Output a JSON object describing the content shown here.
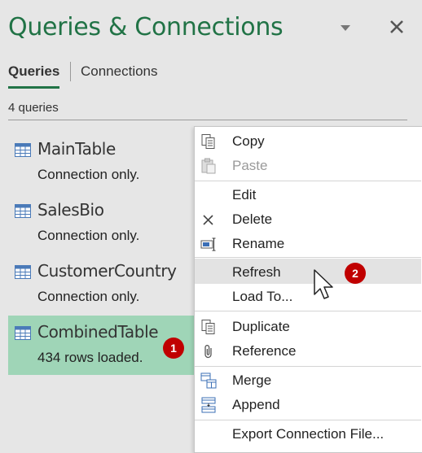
{
  "pane": {
    "title": "Queries & Connections"
  },
  "tabs": {
    "queries": "Queries",
    "connections": "Connections"
  },
  "query_count": "4 queries",
  "queries": [
    {
      "name": "MainTable",
      "status": "Connection only."
    },
    {
      "name": "SalesBio",
      "status": "Connection only."
    },
    {
      "name": "CustomerCountry",
      "status": "Connection only."
    },
    {
      "name": "CombinedTable",
      "status": "434 rows loaded."
    }
  ],
  "context_menu": {
    "items": [
      {
        "label": "Copy",
        "icon": "copy-icon"
      },
      {
        "label": "Paste",
        "icon": "paste-icon",
        "disabled": true
      },
      {
        "label": "Edit"
      },
      {
        "label": "Delete",
        "icon": "delete-icon"
      },
      {
        "label": "Rename",
        "icon": "rename-icon"
      },
      {
        "label": "Refresh",
        "hover": true
      },
      {
        "label": "Load To..."
      },
      {
        "label": "Duplicate",
        "icon": "duplicate-icon"
      },
      {
        "label": "Reference",
        "icon": "reference-icon"
      },
      {
        "label": "Merge",
        "icon": "merge-icon"
      },
      {
        "label": "Append",
        "icon": "append-icon"
      },
      {
        "label": "Export Connection File..."
      }
    ]
  },
  "callouts": {
    "first": "1",
    "second": "2"
  },
  "colors": {
    "accent": "#217346",
    "selected": "#9fd5b7",
    "badge": "#c00000"
  }
}
